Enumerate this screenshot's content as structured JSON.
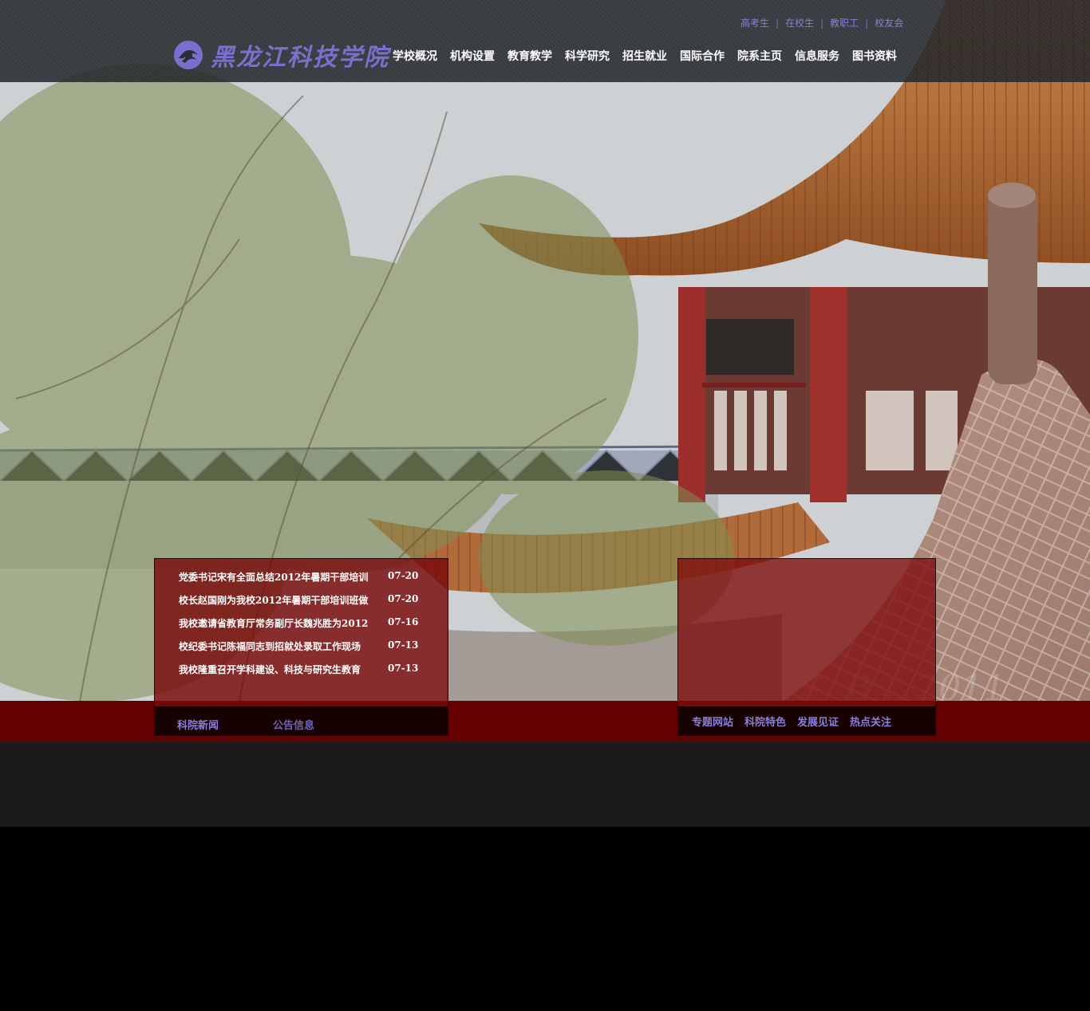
{
  "brand": {
    "logo_text": "黑龙江科技学院"
  },
  "top_links": [
    "高考生",
    "在校生",
    "教职工",
    "校友会"
  ],
  "main_nav": [
    "学校概况",
    "机构设置",
    "教育教学",
    "科学研究",
    "招生就业",
    "国际合作",
    "院系主页",
    "信息服务",
    "图书资料"
  ],
  "news": {
    "items": [
      {
        "title": "党委书记宋有全面总结2012年暑期干部培训",
        "date": "07-20"
      },
      {
        "title": "校长赵国刚为我校2012年暑期干部培训班做",
        "date": "07-20"
      },
      {
        "title": "我校邀请省教育厅常务副厅长魏兆胜为2012",
        "date": "07-16"
      },
      {
        "title": "校纪委书记陈福同志到招就处录取工作现场",
        "date": "07-13"
      },
      {
        "title": "我校隆重召开学科建设、科技与研究生教育",
        "date": "07-13"
      }
    ],
    "tabs": [
      "科院新闻",
      "公告信息"
    ]
  },
  "features": {
    "tabs": [
      "专题网站",
      "科院特色",
      "发展见证",
      "热点关注"
    ]
  },
  "colors": {
    "accent": "#8a7fd8",
    "band_red": "#650000",
    "panel_red": "#7a0808"
  }
}
